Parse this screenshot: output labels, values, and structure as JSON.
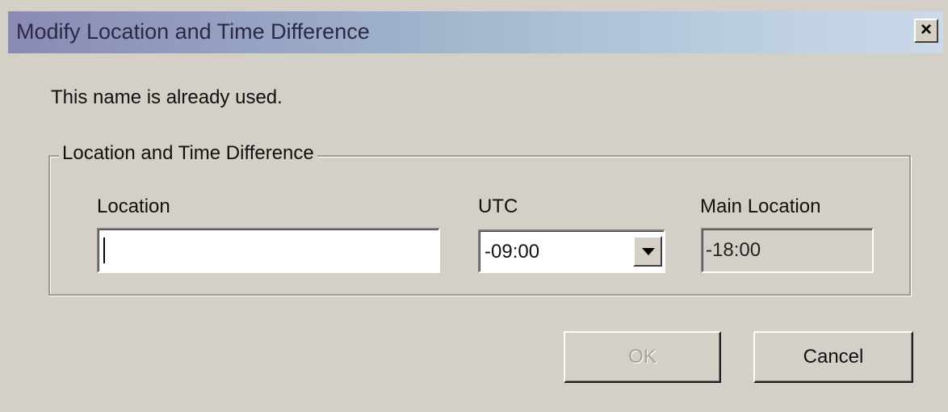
{
  "window": {
    "title": "Modify Location and Time Difference",
    "close_glyph": "×"
  },
  "message": "This name is already used.",
  "group": {
    "title": "Location and Time Difference",
    "location": {
      "label": "Location",
      "value": ""
    },
    "utc": {
      "label": "UTC",
      "selected": "-09:00"
    },
    "main_location": {
      "label": "Main Location",
      "value": "-18:00"
    }
  },
  "buttons": {
    "ok_label": "OK",
    "ok_enabled": false,
    "cancel_label": "Cancel"
  },
  "icons": {
    "close": "close-icon",
    "dropdown": "chevron-down-icon"
  }
}
